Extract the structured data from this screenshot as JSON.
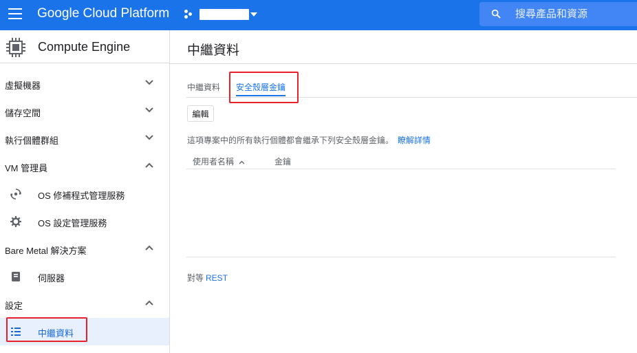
{
  "topbar": {
    "title": "Google Cloud Platform",
    "search_placeholder": "搜尋產品和資源",
    "color": "#1a73e8"
  },
  "sidebar": {
    "title": "Compute Engine",
    "sections": [
      {
        "label": "虛擬機器",
        "expanded": false
      },
      {
        "label": "儲存空間",
        "expanded": false
      },
      {
        "label": "執行個體群組",
        "expanded": false
      },
      {
        "label": "VM 管理員",
        "expanded": true
      },
      {
        "label": "Bare Metal 解決方案",
        "expanded": true
      },
      {
        "label": "設定",
        "expanded": true
      }
    ],
    "items": [
      {
        "label": "OS 修補程式管理服務",
        "icon": "patch-icon"
      },
      {
        "label": "OS 設定管理服務",
        "icon": "gear-icon"
      },
      {
        "label": "伺服器",
        "icon": "server-icon"
      },
      {
        "label": "中繼資料",
        "icon": "list-icon",
        "active": true
      }
    ]
  },
  "main": {
    "page_title": "中繼資料",
    "tabs": [
      {
        "label": "中繼資料",
        "selected": false
      },
      {
        "label": "安全殼層金鑰",
        "selected": true
      }
    ],
    "edit_label": "編輯",
    "info_text": "這項專案中的所有執行個體都會繼承下列安全殼層金鑰。",
    "info_link": "瞭解詳情",
    "columns": [
      "使用者名稱",
      "金鑰"
    ],
    "rest_prefix": "對等",
    "rest_link": "REST"
  }
}
